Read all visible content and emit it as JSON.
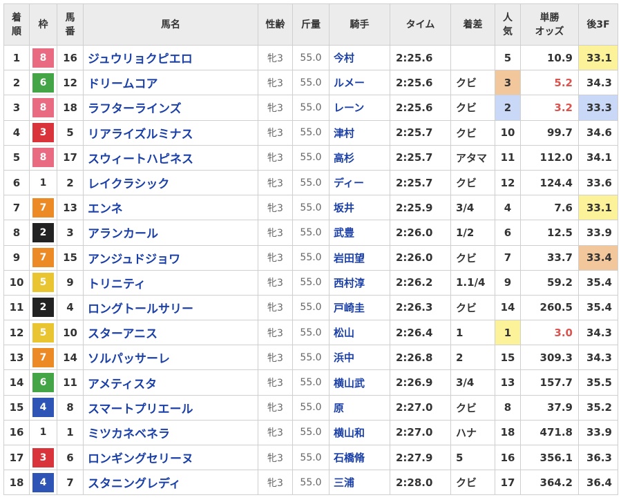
{
  "headers": {
    "rank": [
      "着",
      "順"
    ],
    "waku": "枠",
    "umaban": [
      "馬",
      "番"
    ],
    "name": "馬名",
    "sex_age": "性齢",
    "weight": "斤量",
    "jockey": "騎手",
    "time": "タイム",
    "margin": "着差",
    "pop": [
      "人",
      "気"
    ],
    "odds": [
      "単勝",
      "オッズ"
    ],
    "last3f": "後3F"
  },
  "waku_colors": {
    "1": {
      "bg": "#ffffff",
      "fg": "#333333"
    },
    "2": {
      "bg": "#222222",
      "fg": "#ffffff"
    },
    "3": {
      "bg": "#d9343b",
      "fg": "#ffffff"
    },
    "4": {
      "bg": "#2e55b5",
      "fg": "#ffffff"
    },
    "5": {
      "bg": "#e8c531",
      "fg": "#ffffff"
    },
    "6": {
      "bg": "#44a546",
      "fg": "#ffffff"
    },
    "7": {
      "bg": "#ec8a25",
      "fg": "#ffffff"
    },
    "8": {
      "bg": "#e96b82",
      "fg": "#ffffff"
    }
  },
  "rows": [
    {
      "rank": "1",
      "waku": "8",
      "umaban": "16",
      "name": "ジュウリョクピエロ",
      "sex_age": "牝3",
      "weight": "55.0",
      "jockey": "今村",
      "time": "2:25.6",
      "margin": "",
      "pop": "5",
      "odds": "10.9",
      "last3f": "33.1",
      "pop_rank": 0,
      "f3_rank": 1
    },
    {
      "rank": "2",
      "waku": "6",
      "umaban": "12",
      "name": "ドリームコア",
      "sex_age": "牝3",
      "weight": "55.0",
      "jockey": "ルメー",
      "time": "2:25.6",
      "margin": "クビ",
      "pop": "3",
      "odds": "5.2",
      "last3f": "34.3",
      "pop_rank": 3,
      "f3_rank": 0
    },
    {
      "rank": "3",
      "waku": "8",
      "umaban": "18",
      "name": "ラフターラインズ",
      "sex_age": "牝3",
      "weight": "55.0",
      "jockey": "レーン",
      "time": "2:25.6",
      "margin": "クビ",
      "pop": "2",
      "odds": "3.2",
      "last3f": "33.3",
      "pop_rank": 2,
      "f3_rank": 2
    },
    {
      "rank": "4",
      "waku": "3",
      "umaban": "5",
      "name": "リアライズルミナス",
      "sex_age": "牝3",
      "weight": "55.0",
      "jockey": "津村",
      "time": "2:25.7",
      "margin": "クビ",
      "pop": "10",
      "odds": "99.7",
      "last3f": "34.6",
      "pop_rank": 0,
      "f3_rank": 0
    },
    {
      "rank": "5",
      "waku": "8",
      "umaban": "17",
      "name": "スウィートハピネス",
      "sex_age": "牝3",
      "weight": "55.0",
      "jockey": "高杉",
      "time": "2:25.7",
      "margin": "アタマ",
      "pop": "11",
      "odds": "112.0",
      "last3f": "34.1",
      "pop_rank": 0,
      "f3_rank": 0
    },
    {
      "rank": "6",
      "waku": "1",
      "umaban": "2",
      "name": "レイクラシック",
      "sex_age": "牝3",
      "weight": "55.0",
      "jockey": "ディー",
      "time": "2:25.7",
      "margin": "クビ",
      "pop": "12",
      "odds": "124.4",
      "last3f": "33.6",
      "pop_rank": 0,
      "f3_rank": 0
    },
    {
      "rank": "7",
      "waku": "7",
      "umaban": "13",
      "name": "エンネ",
      "sex_age": "牝3",
      "weight": "55.0",
      "jockey": "坂井",
      "time": "2:25.9",
      "margin": "3/4",
      "pop": "4",
      "odds": "7.6",
      "last3f": "33.1",
      "pop_rank": 0,
      "f3_rank": 1
    },
    {
      "rank": "8",
      "waku": "2",
      "umaban": "3",
      "name": "アランカール",
      "sex_age": "牝3",
      "weight": "55.0",
      "jockey": "武豊",
      "time": "2:26.0",
      "margin": "1/2",
      "pop": "6",
      "odds": "12.5",
      "last3f": "33.9",
      "pop_rank": 0,
      "f3_rank": 0
    },
    {
      "rank": "9",
      "waku": "7",
      "umaban": "15",
      "name": "アンジュドジョワ",
      "sex_age": "牝3",
      "weight": "55.0",
      "jockey": "岩田望",
      "time": "2:26.0",
      "margin": "クビ",
      "pop": "7",
      "odds": "33.7",
      "last3f": "33.4",
      "pop_rank": 0,
      "f3_rank": 3
    },
    {
      "rank": "10",
      "waku": "5",
      "umaban": "9",
      "name": "トリニティ",
      "sex_age": "牝3",
      "weight": "55.0",
      "jockey": "西村淳",
      "time": "2:26.2",
      "margin": "1.1/4",
      "pop": "9",
      "odds": "59.2",
      "last3f": "35.4",
      "pop_rank": 0,
      "f3_rank": 0
    },
    {
      "rank": "11",
      "waku": "2",
      "umaban": "4",
      "name": "ロングトールサリー",
      "sex_age": "牝3",
      "weight": "55.0",
      "jockey": "戸崎圭",
      "time": "2:26.3",
      "margin": "クビ",
      "pop": "14",
      "odds": "260.5",
      "last3f": "35.4",
      "pop_rank": 0,
      "f3_rank": 0
    },
    {
      "rank": "12",
      "waku": "5",
      "umaban": "10",
      "name": "スターアニス",
      "sex_age": "牝3",
      "weight": "55.0",
      "jockey": "松山",
      "time": "2:26.4",
      "margin": "1",
      "pop": "1",
      "odds": "3.0",
      "last3f": "34.3",
      "pop_rank": 1,
      "f3_rank": 0
    },
    {
      "rank": "13",
      "waku": "7",
      "umaban": "14",
      "name": "ソルパッサーレ",
      "sex_age": "牝3",
      "weight": "55.0",
      "jockey": "浜中",
      "time": "2:26.8",
      "margin": "2",
      "pop": "15",
      "odds": "309.3",
      "last3f": "34.3",
      "pop_rank": 0,
      "f3_rank": 0
    },
    {
      "rank": "14",
      "waku": "6",
      "umaban": "11",
      "name": "アメティスタ",
      "sex_age": "牝3",
      "weight": "55.0",
      "jockey": "横山武",
      "time": "2:26.9",
      "margin": "3/4",
      "pop": "13",
      "odds": "157.7",
      "last3f": "35.5",
      "pop_rank": 0,
      "f3_rank": 0
    },
    {
      "rank": "15",
      "waku": "4",
      "umaban": "8",
      "name": "スマートプリエール",
      "sex_age": "牝3",
      "weight": "55.0",
      "jockey": "原",
      "time": "2:27.0",
      "margin": "クビ",
      "pop": "8",
      "odds": "37.9",
      "last3f": "35.2",
      "pop_rank": 0,
      "f3_rank": 0
    },
    {
      "rank": "16",
      "waku": "1",
      "umaban": "1",
      "name": "ミツカネベネラ",
      "sex_age": "牝3",
      "weight": "55.0",
      "jockey": "横山和",
      "time": "2:27.0",
      "margin": "ハナ",
      "pop": "18",
      "odds": "471.8",
      "last3f": "33.9",
      "pop_rank": 0,
      "f3_rank": 0
    },
    {
      "rank": "17",
      "waku": "3",
      "umaban": "6",
      "name": "ロンギングセリーヌ",
      "sex_age": "牝3",
      "weight": "55.0",
      "jockey": "石橋脩",
      "time": "2:27.9",
      "margin": "5",
      "pop": "16",
      "odds": "356.1",
      "last3f": "36.3",
      "pop_rank": 0,
      "f3_rank": 0
    },
    {
      "rank": "18",
      "waku": "4",
      "umaban": "7",
      "name": "スタニングレディ",
      "sex_age": "牝3",
      "weight": "55.0",
      "jockey": "三浦",
      "time": "2:28.0",
      "margin": "クビ",
      "pop": "17",
      "odds": "364.2",
      "last3f": "36.4",
      "pop_rank": 0,
      "f3_rank": 0
    }
  ]
}
